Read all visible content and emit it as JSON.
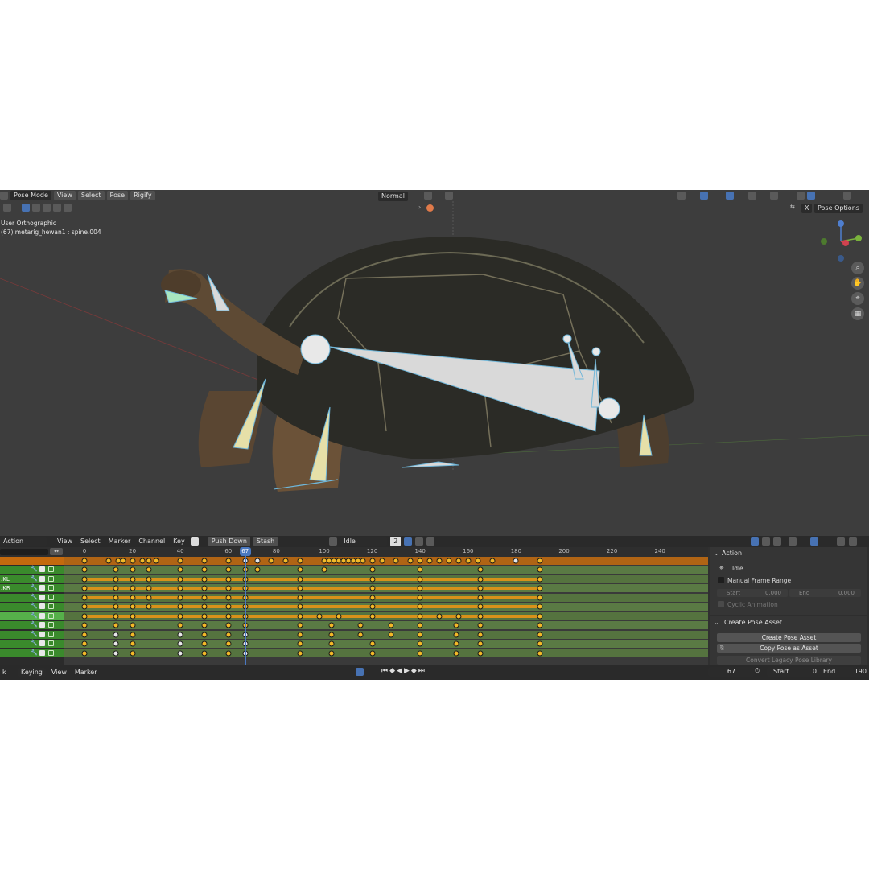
{
  "viewport": {
    "mode_label": "Pose Mode",
    "menus": [
      "View",
      "Select",
      "Pose",
      "Rigify"
    ],
    "orientation_label": "Normal",
    "view_name": "User Orthographic",
    "object_info": "(67) metarig_hewan1 : spine.004",
    "pose_options_label": "Pose Options",
    "x_mirror_label": "X",
    "colors": {
      "background": "#3d3d3d",
      "bone": "#d9d9d9",
      "bone_outline": "#6fb6d9",
      "grid_line": "#7a3a3a"
    }
  },
  "editor": {
    "editor_name": "Action Editor",
    "menus": [
      "View",
      "Select",
      "Marker",
      "Channel",
      "Key"
    ],
    "push_down_label": "Push Down",
    "stash_label": "Stash",
    "action_name": "Idle",
    "action_users": "2",
    "current_frame": "67",
    "ruler_ticks": [
      "0",
      "20",
      "40",
      "60",
      "80",
      "100",
      "120",
      "140",
      "160",
      "180",
      "200",
      "220",
      "240"
    ],
    "channels": [
      {
        "label": ""
      },
      {
        "label": ".KL"
      },
      {
        "label": ".KR"
      },
      {
        "label": ""
      },
      {
        "label": ""
      },
      {
        "label": ""
      },
      {
        "label": ""
      },
      {
        "label": ""
      },
      {
        "label": ""
      },
      {
        "label": ""
      }
    ],
    "keyframe_frames": [
      0,
      10,
      14,
      16,
      20,
      24,
      27,
      30,
      40,
      50,
      60,
      67,
      72,
      78,
      84,
      90,
      100,
      102,
      104,
      106,
      108,
      110,
      112,
      114,
      116,
      120,
      124,
      130,
      136,
      140,
      144,
      148,
      152,
      156,
      160,
      164,
      170,
      180,
      190
    ],
    "row_keyframes": [
      [
        0,
        13,
        20,
        27,
        40,
        50,
        60,
        67,
        72,
        90,
        100,
        120,
        140,
        165,
        190
      ],
      [
        0,
        13,
        20,
        27,
        40,
        50,
        60,
        67,
        90,
        120,
        140,
        165,
        190
      ],
      [
        0,
        13,
        20,
        27,
        40,
        50,
        60,
        67,
        90,
        120,
        140,
        165,
        190
      ],
      [
        0,
        13,
        20,
        27,
        40,
        50,
        60,
        67,
        90,
        120,
        140,
        165,
        190
      ],
      [
        0,
        13,
        20,
        27,
        40,
        50,
        60,
        67,
        90,
        120,
        140,
        165,
        190
      ],
      [
        0,
        13,
        20,
        40,
        50,
        60,
        67,
        90,
        98,
        106,
        120,
        140,
        148,
        156,
        165,
        190
      ],
      [
        0,
        13,
        20,
        40,
        50,
        60,
        67,
        90,
        103,
        115,
        128,
        140,
        155,
        165,
        190
      ],
      [
        0,
        13,
        20,
        40,
        50,
        60,
        67,
        90,
        103,
        115,
        128,
        140,
        155,
        165,
        190
      ],
      [
        0,
        13,
        20,
        40,
        50,
        60,
        67,
        90,
        103,
        120,
        140,
        155,
        165,
        190
      ],
      [
        0,
        13,
        20,
        40,
        50,
        60,
        67,
        90,
        103,
        120,
        140,
        155,
        165,
        190
      ]
    ],
    "hold_rows": [
      1,
      2,
      3,
      4,
      5
    ],
    "colors": {
      "keyframe_selected": "#f2b928",
      "keyframe": "#e8e8e8",
      "hold_bar": "#d8911a",
      "summary_row": "#c46a0e",
      "channel_row": "#3a8a2c",
      "channel_row_sel": "#56b04a",
      "green_track": "#55733f"
    }
  },
  "sidebar": {
    "action_panel_title": "Action",
    "action_name": "Idle",
    "manual_frame_range_label": "Manual Frame Range",
    "start_label": "Start",
    "start_value": "0.000",
    "end_label": "End",
    "end_value": "0.000",
    "cyclic_label": "Cyclic Animation",
    "pose_asset_title": "Create Pose Asset",
    "create_pose_label": "Create Pose Asset",
    "copy_pose_label": "Copy Pose as Asset",
    "convert_label": "Convert Legacy Pose Library"
  },
  "footer": {
    "keying_label": "Keying",
    "view_label": "View",
    "marker_label": "Marker",
    "current_frame": "67",
    "start_label": "Start",
    "start_value": "0",
    "end_label": "End",
    "end_value": "190"
  }
}
